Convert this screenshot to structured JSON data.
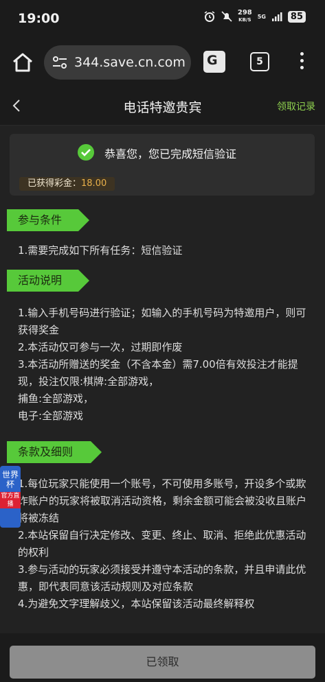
{
  "status_bar": {
    "time": "19:00",
    "net_speed_value": "298",
    "net_speed_unit": "KB/S",
    "network": "5G",
    "battery": "85"
  },
  "browser": {
    "url": "344.save.cn.com",
    "tab_count": "5"
  },
  "header": {
    "title": "电话特邀贵宾",
    "records_link": "领取记录"
  },
  "verify": {
    "message": "恭喜您，您已完成短信验证",
    "prize_label": "已获得彩金：",
    "prize_value": "18.00"
  },
  "conditions": {
    "title": "参与条件",
    "lines": [
      "1.需要完成如下所有任务：短信验证"
    ]
  },
  "description": {
    "title": "活动说明",
    "lines": [
      "1.输入手机号码进行验证；如输入的手机号码为特邀用户，则可获得奖金",
      "2.本活动仅可参与一次，过期即作废",
      "3.本活动所赠送的奖金（不含本金）需7.00倍有效投注才能提现，投注仅限:棋牌:全部游戏，",
      "捕鱼:全部游戏，",
      "电子:全部游戏"
    ]
  },
  "terms": {
    "title": "条款及细则",
    "lines": [
      "1.每位玩家只能使用一个账号，不可使用多账号，开设多个或欺诈账户的玩家将被取消活动资格，剩余金额可能会被没收且账户将被冻结",
      "2.本站保留自行决定修改、变更、终止、取消、拒绝此优惠活动的权利",
      "3.参与活动的玩家必须接受并遵守本活动的条款，并且申请此优惠，即代表同意该活动规则及对应条款",
      "4.为避免文字理解歧义，本站保留该活动最终解释权"
    ]
  },
  "floating_badge": {
    "title": "世界杯",
    "subtitle": "官方直播"
  },
  "bottom": {
    "claimed_label": "已领取"
  },
  "colors": {
    "accent_green": "#57c93a",
    "link_green": "#8fd14f",
    "prize_gold": "#e9b04a",
    "background": "#222222"
  }
}
